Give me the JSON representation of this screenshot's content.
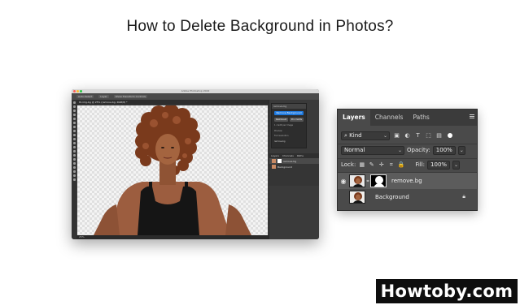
{
  "headline": "How to Delete Background in Photos?",
  "photoshop_window": {
    "title": "Adobe Photoshop 2022",
    "doc_tab": "Ps img-bg @ 25% (remove.bg, RGB/8) *",
    "status": "25%",
    "options": [
      "Auto-Select",
      "Layer",
      "Show Transform Controls"
    ],
    "plugin": {
      "title": "remove.bg",
      "primary_button": "Remove Background",
      "buttons": [
        "Dashboard",
        "Pro credits"
      ],
      "text_lines": [
        "1 credit per image",
        "Preview",
        "Full resolution"
      ],
      "credits_label": "remove.bg"
    },
    "small_layers": {
      "tabs": [
        "Layers",
        "Channels",
        "Paths"
      ],
      "layers": [
        "remove.bg",
        "Background"
      ]
    }
  },
  "layers_panel": {
    "tabs": [
      "Layers",
      "Channels",
      "Paths"
    ],
    "active_tab": "Layers",
    "filter_kind": "Kind",
    "filter_icons": [
      "image-filter-icon",
      "adjustment-filter-icon",
      "type-filter-icon",
      "shape-filter-icon",
      "smart-object-filter-icon"
    ],
    "blend_mode": "Normal",
    "opacity_label": "Opacity:",
    "opacity_value": "100%",
    "lock_label": "Lock:",
    "fill_label": "Fill:",
    "fill_value": "100%",
    "layers": [
      {
        "name": "remove.bg",
        "visible": true,
        "selected": true,
        "has_mask": true
      },
      {
        "name": "Background",
        "visible": false,
        "selected": false,
        "locked": true
      }
    ]
  },
  "logo": {
    "text": "Howtoby.com"
  },
  "colors": {
    "panel_bg": "#4a4a4a",
    "tab_bar": "#3b3b3b",
    "selected_layer": "#5c5c5c",
    "plugin_blue": "#1f7ae0",
    "logo_bg": "#0e0e0e"
  }
}
